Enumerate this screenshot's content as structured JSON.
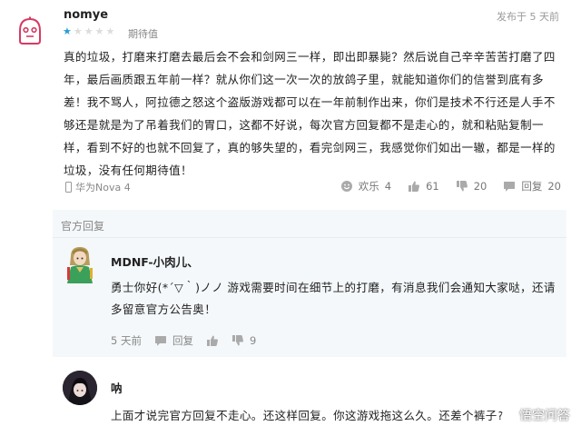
{
  "review": {
    "username": "nomye",
    "posted_time": "发布于 5 天前",
    "rating_stars": 1,
    "rating_max": 5,
    "rating_label": "期待值",
    "body": "真的垃圾，打磨来打磨去最后会不会和剑网三一样，即出即暴毙？然后说自己辛辛苦苦打磨了四年，最后画质跟五年前一样？就从你们这一次一次的放鸽子里，就能知道你们的信誉到底有多差！我不骂人，阿拉德之怒这个盗版游戏都可以在一年前制作出来，你们是技术不行还是人手不够还是就是为了吊着我们的胃口，这都不好说，每次官方回复都不是走心的，就和粘贴复制一样，看到不好的也就不回复了，真的够失望的，看完剑网三，我感觉你们如出一辙，都是一样的垃圾，没有任何期待值！",
    "device": "华为Nova 4",
    "actions": {
      "happy_label": "欢乐",
      "happy_count": "4",
      "like_count": "61",
      "dislike_count": "20",
      "reply_label": "回复",
      "reply_count": "20"
    }
  },
  "official_reply": {
    "section_title": "官方回复",
    "dev_name": "MDNF-小肉儿、",
    "body": "勇士你好(*´▽｀)ノノ 游戏需要时间在细节上的打磨，有消息我们会通知大家哒，还请多留意官方公告奥！",
    "time": "5 天前",
    "reply_label": "回复",
    "dislike_count": "9"
  },
  "comment": {
    "username": "呐",
    "body": "上面才说完官方回复不走心。还这样回复。你这游戏拖这么久。还差个裤子?"
  },
  "watermark": {
    "text": "悟空问答"
  },
  "colors": {
    "star_active": "#2a9bd6",
    "star_inactive": "#dcdcdc",
    "official_bg": "#f4f8fa"
  }
}
